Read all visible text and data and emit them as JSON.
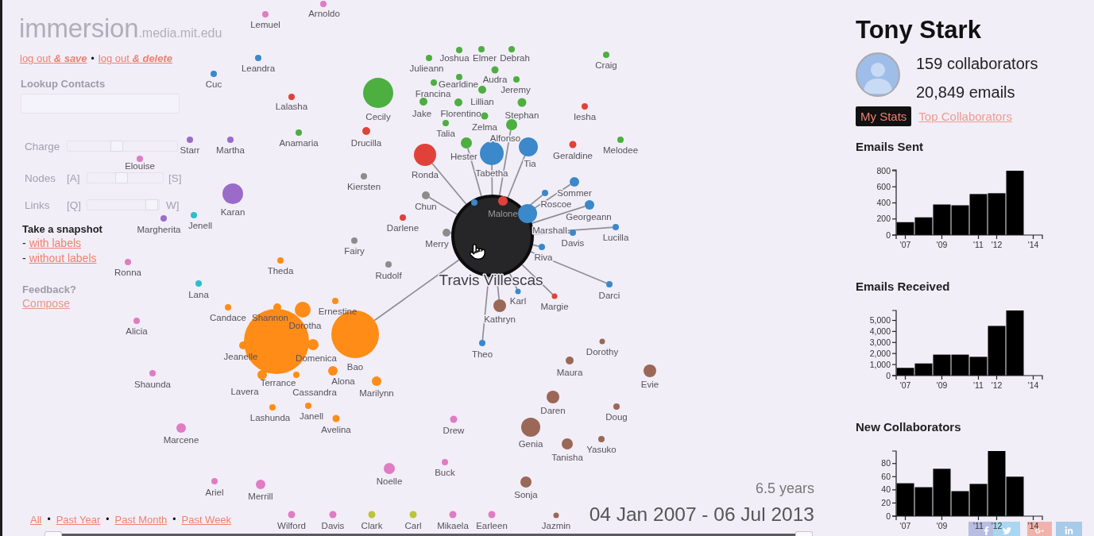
{
  "logo": {
    "name": "immersion",
    "domain": ".media.mit.edu"
  },
  "account_links": [
    {
      "label": "log out *& save*"
    },
    {
      "label": "log out *& delete*",
      "separator": "•"
    }
  ],
  "lookup": {
    "label": "Lookup Contacts"
  },
  "sliders": [
    {
      "label": "Charge",
      "level": 0.45
    },
    {
      "label": "Nodes",
      "left_key": "[A]",
      "right_key": "[S]",
      "level": 0.45
    },
    {
      "label": "Links",
      "left_key": "[Q]",
      "right_key": "W]",
      "level": 0.9
    }
  ],
  "snapshot": {
    "title": "Take a snapshot",
    "options": [
      {
        "bullet": "-",
        "label": "with labels"
      },
      {
        "bullet": "-",
        "label": "without labels"
      }
    ]
  },
  "feedback": {
    "title": "Feedback?",
    "link": "Compose"
  },
  "time_ranges": [
    {
      "label": "All"
    },
    {
      "label": "Past Year",
      "separator": "•"
    },
    {
      "label": "Past Month",
      "separator": "•"
    },
    {
      "label": "Past Week",
      "separator": "•"
    }
  ],
  "focused_contact": {
    "label": "Travis Villescas"
  },
  "contacts": [
    {
      "label": "Arnoldo",
      "color": "#e07cc3",
      "linked": false
    },
    {
      "label": "Lemuel",
      "color": "#e07cc3",
      "linked": false
    },
    {
      "label": "Leandra",
      "color": "#3b88ca",
      "linked": false
    },
    {
      "label": "Julieann",
      "color": "#4caf3f",
      "linked": false
    },
    {
      "label": "Joshua",
      "color": "#4caf3f",
      "linked": false
    },
    {
      "label": "Elmer",
      "color": "#4caf3f",
      "linked": false
    },
    {
      "label": "Debrah",
      "color": "#4caf3f",
      "linked": false
    },
    {
      "label": "Craig",
      "color": "#4caf3f",
      "linked": false
    },
    {
      "label": "Cuc",
      "color": "#3b88ca",
      "linked": false
    },
    {
      "label": "Francina",
      "color": "#4caf3f",
      "linked": false
    },
    {
      "label": "Gearldine",
      "color": "#4caf3f",
      "linked": false
    },
    {
      "label": "Audra",
      "color": "#4caf3f",
      "linked": false
    },
    {
      "label": "Jeremy",
      "color": "#4caf3f",
      "linked": false
    },
    {
      "label": "Lalasha",
      "color": "#e0423a",
      "linked": false
    },
    {
      "label": "Cecily",
      "color": "#4caf3f",
      "linked": false
    },
    {
      "label": "Jake",
      "color": "#4caf3f",
      "linked": false
    },
    {
      "label": "Florentino",
      "color": "#4caf3f",
      "linked": false
    },
    {
      "label": "Lillian",
      "color": "#4caf3f",
      "linked": false
    },
    {
      "label": "Stephan",
      "color": "#4caf3f",
      "linked": false
    },
    {
      "label": "Iesha",
      "color": "#e0423a",
      "linked": false
    },
    {
      "label": "Talia",
      "color": "#4caf3f",
      "linked": false
    },
    {
      "label": "Zelma",
      "color": "#4caf3f",
      "linked": false
    },
    {
      "label": "Alfonso",
      "color": "#4caf3f",
      "linked": true
    },
    {
      "label": "Starr",
      "color": "#9b6bc9",
      "linked": false
    },
    {
      "label": "Martha",
      "color": "#9b6bc9",
      "linked": false
    },
    {
      "label": "Anamaria",
      "color": "#4caf3f",
      "linked": false
    },
    {
      "label": "Drucilla",
      "color": "#e0423a",
      "linked": false
    },
    {
      "label": "Hester",
      "color": "#4caf3f",
      "linked": true
    },
    {
      "label": "Geraldine",
      "color": "#e0423a",
      "linked": false
    },
    {
      "label": "Melodee",
      "color": "#4caf3f",
      "linked": false
    },
    {
      "label": "Elouise",
      "color": "#e07cc3",
      "linked": false
    },
    {
      "label": "Ronda",
      "color": "#e0423a",
      "linked": true
    },
    {
      "label": "Tabetha",
      "color": "#3b88ca",
      "linked": true
    },
    {
      "label": "Tia",
      "color": "#3b88ca",
      "linked": true
    },
    {
      "label": "Kiersten",
      "color": "#8c8c8c",
      "linked": false
    },
    {
      "label": "Sommer",
      "color": "#3b88ca",
      "linked": true
    },
    {
      "label": "Karan",
      "color": "#9b6bc9",
      "linked": false
    },
    {
      "label": "Chun",
      "color": "#8c8c8c",
      "linked": true
    },
    {
      "color": "#3b88ca",
      "linked": false
    },
    {
      "label": "Malone",
      "color": "#e0423a",
      "linked": false
    },
    {
      "label": "Roscoe",
      "color": "#3b88ca",
      "linked": true
    },
    {
      "label": "Georgeann",
      "color": "#3b88ca",
      "linked": true
    },
    {
      "label": "Margherita",
      "color": "#9b6bc9",
      "linked": false
    },
    {
      "label": "Jenell",
      "color": "#2dbecb",
      "linked": false
    },
    {
      "label": "Darlene",
      "color": "#e0423a",
      "linked": false
    },
    {
      "label": "Merry",
      "color": "#8c8c8c",
      "linked": true
    },
    {
      "label": "Marshall",
      "color": "#3b88ca",
      "linked": true
    },
    {
      "label": "Davis",
      "color": "#3b88ca",
      "linked": true
    },
    {
      "label": "Lucilla",
      "color": "#3b88ca",
      "linked": true
    },
    {
      "label": "Fairy",
      "color": "#8c8c8c",
      "linked": false
    },
    {
      "label": "Riva",
      "color": "#3b88ca",
      "linked": true
    },
    {
      "label": "Ronna",
      "color": "#e07cc3",
      "linked": false
    },
    {
      "label": "Theda",
      "color": "#ff8c16",
      "linked": false
    },
    {
      "label": "Rudolf",
      "color": "#8c8c8c",
      "linked": false
    },
    {
      "label": "Lana",
      "color": "#2dbecb",
      "linked": false
    },
    {
      "label": "Karl",
      "color": "#3b88ca",
      "linked": true
    },
    {
      "label": "Margie",
      "color": "#e0423a",
      "linked": true
    },
    {
      "label": "Darci",
      "color": "#3b88ca",
      "linked": true
    },
    {
      "label": "Alicia",
      "color": "#e07cc3",
      "linked": false
    },
    {
      "label": "Candace",
      "color": "#ff8c16",
      "linked": false
    },
    {
      "label": "Shannon",
      "color": "#ff8c16",
      "linked": false
    },
    {
      "label": "Dorotha",
      "color": "#ff8c16",
      "linked": false
    },
    {
      "label": "Ernestine",
      "color": "#ff8c16",
      "linked": false
    },
    {
      "label": "Kathryn",
      "color": "#9b6757",
      "linked": true
    },
    {
      "label": "Jeanelle",
      "color": "#ff8c16",
      "linked": false
    },
    {
      "label": "Domenica",
      "color": "#ff8c16",
      "linked": false
    },
    {
      "label": "Theo",
      "color": "#3b88ca",
      "linked": true
    },
    {
      "label": "Dorothy",
      "color": "#9b6757",
      "linked": false
    },
    {
      "label": "Bao",
      "color": "#ff8c16",
      "linked": true
    },
    {
      "label": "Maura",
      "color": "#9b6757",
      "linked": false
    },
    {
      "label": "Shaunda",
      "color": "#e07cc3",
      "linked": false
    },
    {
      "label": "Lavera",
      "color": "#ff8c16",
      "linked": false
    },
    {
      "label": "Terrance",
      "color": "#ff8c16",
      "linked": false
    },
    {
      "label": "Cassandra",
      "color": "#ff8c16",
      "linked": false
    },
    {
      "label": "Alona",
      "color": "#ff8c16",
      "linked": false
    },
    {
      "label": "Marilynn",
      "color": "#ff8c16",
      "linked": false
    },
    {
      "label": "Evie",
      "color": "#9b6757",
      "linked": false
    },
    {
      "label": "Lashunda",
      "color": "#ff8c16",
      "linked": false
    },
    {
      "label": "Janell",
      "color": "#ff8c16",
      "linked": false
    },
    {
      "label": "Daren",
      "color": "#9b6757",
      "linked": false
    },
    {
      "label": "Doug",
      "color": "#9b6757",
      "linked": false
    },
    {
      "label": "Marcene",
      "color": "#e07cc3",
      "linked": false
    },
    {
      "label": "Avelina",
      "color": "#ff8c16",
      "linked": false
    },
    {
      "label": "Drew",
      "color": "#e07cc3",
      "linked": false
    },
    {
      "label": "Genia",
      "color": "#9b6757",
      "linked": false
    },
    {
      "label": "Tanisha",
      "color": "#9b6757",
      "linked": false
    },
    {
      "label": "Yasuko",
      "color": "#9b6757",
      "linked": false
    },
    {
      "label": "Ariel",
      "color": "#e07cc3",
      "linked": false
    },
    {
      "label": "Merrill",
      "color": "#e07cc3",
      "linked": false
    },
    {
      "label": "Noelle",
      "color": "#e07cc3",
      "linked": false
    },
    {
      "label": "Buck",
      "color": "#e07cc3",
      "linked": false
    },
    {
      "label": "Sonja",
      "color": "#9b6757",
      "linked": false
    },
    {
      "label": "Wilford",
      "color": "#e07cc3",
      "linked": false
    },
    {
      "label": "Davis",
      "color": "#e07cc3",
      "linked": false
    },
    {
      "label": "Clark",
      "color": "#bcc43b",
      "linked": false
    },
    {
      "label": "Carl",
      "color": "#bcc43b",
      "linked": false
    },
    {
      "label": "Mikaela",
      "color": "#e07cc3",
      "linked": false
    },
    {
      "label": "Earleen",
      "color": "#e07cc3",
      "linked": false
    },
    {
      "label": "Jazmin",
      "color": "#9b6757",
      "linked": false
    }
  ],
  "period": {
    "duration": "6.5 years",
    "range": "04 Jan 2007 - 06 Jul 2013"
  },
  "profile": {
    "name": "Tony Stark",
    "collaborators": "159 collaborators",
    "emails": "20,849 emails"
  },
  "tabs": [
    {
      "label": "My Stats",
      "selected": true
    },
    {
      "label": "Top Collaborators",
      "selected": false
    }
  ],
  "charts": [
    {
      "chart_data": {
        "type": "bar",
        "title": "Emails Sent",
        "x": [
          2007,
          2008,
          2009,
          2010,
          2011,
          2012,
          2013
        ],
        "values": [
          160,
          220,
          380,
          370,
          510,
          520,
          800
        ],
        "xlim": [
          2006.5,
          2014.5
        ],
        "ylim": [
          0,
          810
        ],
        "xticks": [
          {
            "value": 2007,
            "label": "'07"
          },
          {
            "value": 2009,
            "label": "'09"
          },
          {
            "value": 2011,
            "label": "'11"
          },
          {
            "value": 2012,
            "label": "'12"
          },
          {
            "value": 2014,
            "label": "'14"
          }
        ],
        "yticks": [
          0,
          200,
          400,
          600,
          800
        ]
      }
    },
    {
      "chart_data": {
        "type": "bar",
        "title": "Emails Received",
        "x": [
          2007,
          2008,
          2009,
          2010,
          2011,
          2012,
          2013
        ],
        "values": [
          700,
          1100,
          1900,
          1900,
          1700,
          4500,
          5900
        ],
        "xlim": [
          2006.5,
          2014.5
        ],
        "ylim": [
          0,
          5900
        ],
        "xticks": [
          {
            "value": 2007,
            "label": "'07"
          },
          {
            "value": 2009,
            "label": "'09"
          },
          {
            "value": 2011,
            "label": "'11"
          },
          {
            "value": 2012,
            "label": "'12"
          },
          {
            "value": 2014,
            "label": "'14"
          }
        ],
        "yticks": [
          0,
          {
            "value": 1000,
            "label": "1,000"
          },
          {
            "value": 2000,
            "label": "2,000"
          },
          {
            "value": 3000,
            "label": "3,000"
          },
          {
            "value": 4000,
            "label": "4,000"
          },
          {
            "value": 5000,
            "label": "5,000"
          }
        ]
      }
    },
    {
      "chart_data": {
        "type": "bar",
        "title": "New Collaborators",
        "x": [
          2007,
          2008,
          2009,
          2010,
          2011,
          2012,
          2013
        ],
        "values": [
          50,
          44,
          72,
          38,
          49,
          99,
          60
        ],
        "xlim": [
          2006.5,
          2014.5
        ],
        "ylim": [
          0,
          99
        ],
        "xticks": [
          {
            "value": 2007,
            "label": "'07"
          },
          {
            "value": 2009,
            "label": "'09"
          },
          {
            "value": 2011,
            "label": "'11"
          },
          {
            "value": 2012,
            "label": "'12"
          },
          {
            "value": 2014,
            "label": "'14"
          }
        ],
        "yticks": [
          0,
          20,
          40,
          60,
          80
        ]
      }
    }
  ]
}
